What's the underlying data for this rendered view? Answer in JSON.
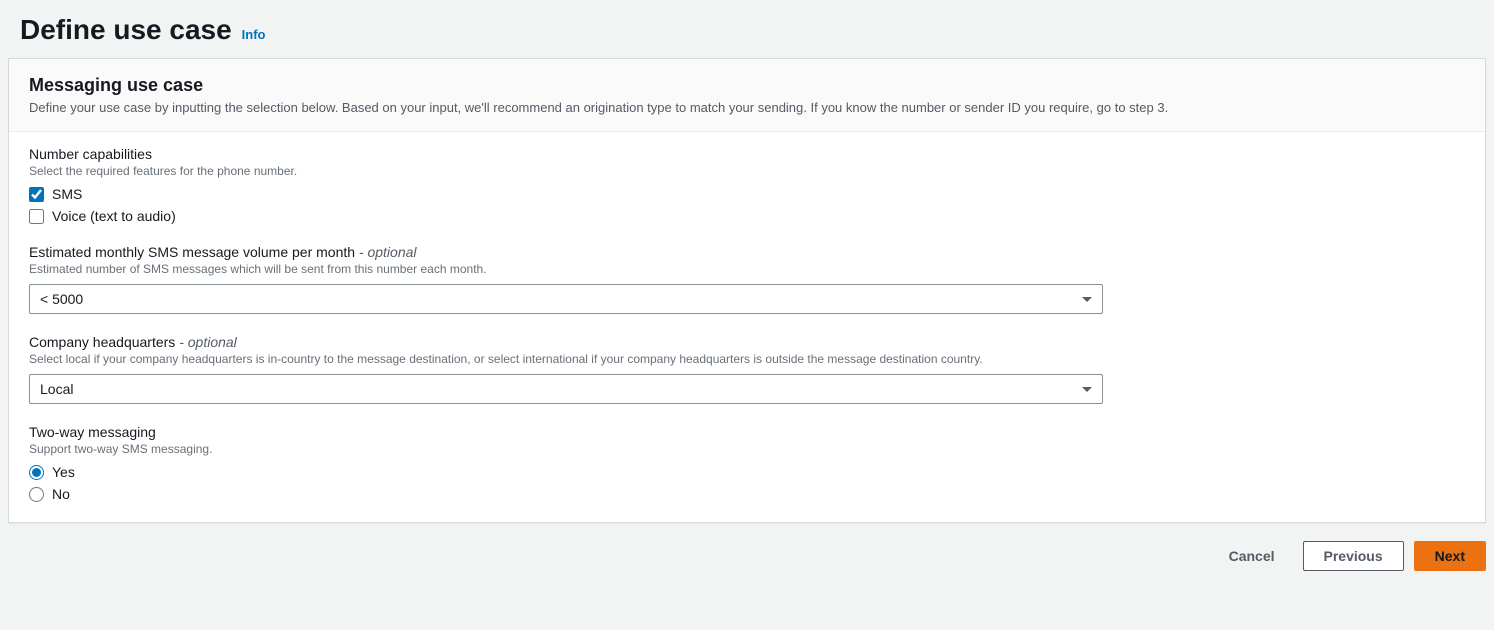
{
  "header": {
    "title": "Define use case",
    "info": "Info"
  },
  "panel": {
    "title": "Messaging use case",
    "description": "Define your use case by inputting the selection below. Based on your input, we'll recommend an origination type to match your sending. If you know the number or sender ID you require, go to step 3."
  },
  "numberCapabilities": {
    "label": "Number capabilities",
    "hint": "Select the required features for the phone number.",
    "options": {
      "sms": "SMS",
      "voice": "Voice (text to audio)"
    }
  },
  "volume": {
    "label": "Estimated monthly SMS message volume per month",
    "optional": "- optional",
    "hint": "Estimated number of SMS messages which will be sent from this number each month.",
    "value": "< 5000"
  },
  "headquarters": {
    "label": "Company headquarters",
    "optional": "- optional",
    "hint": "Select local if your company headquarters is in-country to the message destination, or select international if your company headquarters is outside the message destination country.",
    "value": "Local"
  },
  "twoWay": {
    "label": "Two-way messaging",
    "hint": "Support two-way SMS messaging.",
    "options": {
      "yes": "Yes",
      "no": "No"
    }
  },
  "footer": {
    "cancel": "Cancel",
    "previous": "Previous",
    "next": "Next"
  }
}
